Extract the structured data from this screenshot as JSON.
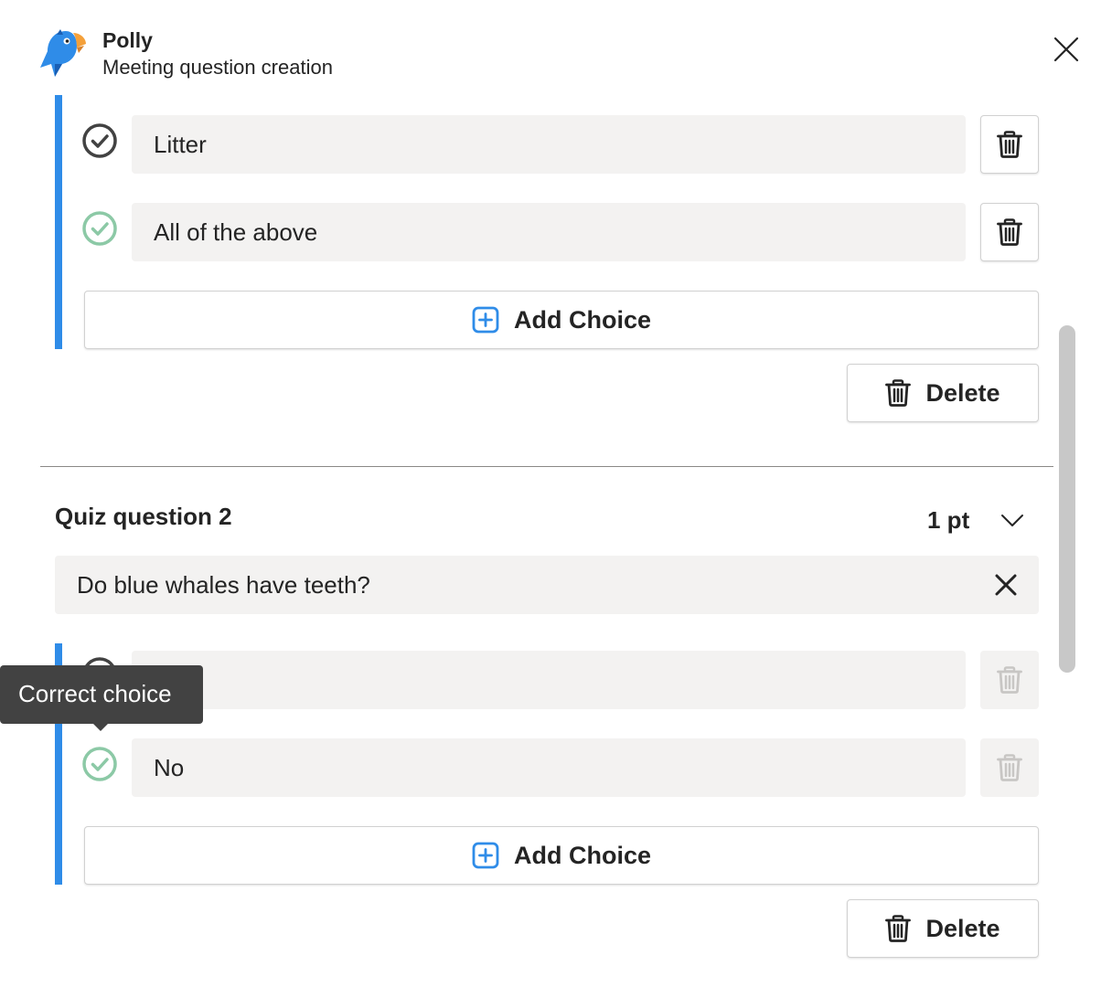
{
  "header": {
    "app_name": "Polly",
    "subtitle": "Meeting question creation"
  },
  "question1": {
    "choices": [
      {
        "text": "Litter",
        "correct": false
      },
      {
        "text": "All of the above",
        "correct": true
      }
    ],
    "add_choice_label": "Add Choice",
    "delete_label": "Delete"
  },
  "question2": {
    "title": "Quiz question 2",
    "points": "1 pt",
    "question_text": "Do blue whales have teeth?",
    "choices": [
      {
        "text": "",
        "correct": false
      },
      {
        "text": "No",
        "correct": true
      }
    ],
    "add_choice_label": "Add Choice",
    "delete_label": "Delete"
  },
  "tooltip": {
    "text": "Correct choice"
  },
  "colors": {
    "accent": "#2f8ce8",
    "correct_green": "#8cc9a6",
    "neutral_check": "#424242",
    "field_bg": "#f3f2f1"
  },
  "icons": {
    "close": "close-icon",
    "trash": "trash-icon",
    "add": "add-square-icon",
    "check": "check-circle-icon",
    "chevron": "chevron-down-icon",
    "clear": "clear-icon"
  }
}
